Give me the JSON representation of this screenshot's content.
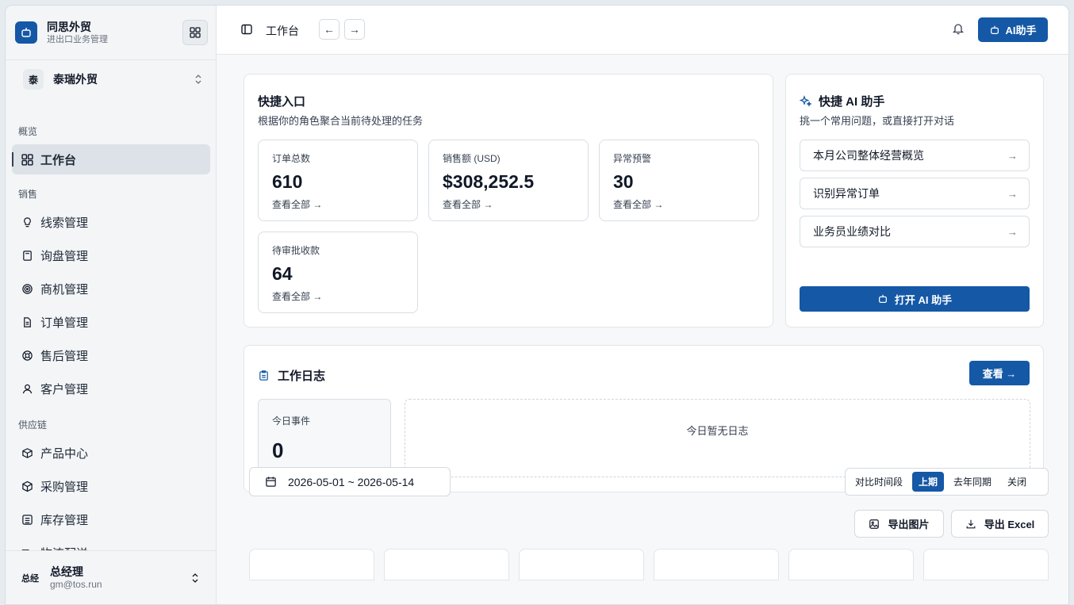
{
  "brand": {
    "name": "同思外贸",
    "subtitle": "进出口业务管理"
  },
  "company": {
    "badge": "泰",
    "name": "泰瑞外贸"
  },
  "sidebar": {
    "sections": {
      "overview": "概览",
      "sales": "销售",
      "supply": "供应链"
    },
    "items": [
      {
        "label": "工作台",
        "icon": "dashboard-icon"
      },
      {
        "label": "线索管理",
        "icon": "lightbulb-icon"
      },
      {
        "label": "询盘管理",
        "icon": "calculator-icon"
      },
      {
        "label": "商机管理",
        "icon": "target-icon"
      },
      {
        "label": "订单管理",
        "icon": "document-icon"
      },
      {
        "label": "售后管理",
        "icon": "lifebuoy-icon"
      },
      {
        "label": "客户管理",
        "icon": "user-icon"
      },
      {
        "label": "产品中心",
        "icon": "package-icon"
      },
      {
        "label": "采购管理",
        "icon": "box-icon"
      },
      {
        "label": "库存管理",
        "icon": "warehouse-icon"
      },
      {
        "label": "物流配送",
        "icon": "truck-icon"
      }
    ]
  },
  "user": {
    "avatar": "总经",
    "name": "总经理",
    "email": "gm@tos.run"
  },
  "header": {
    "title": "工作台",
    "ai_button": "AI助手"
  },
  "quick_entry": {
    "title": "快捷入口",
    "subtitle": "根据你的角色聚合当前待处理的任务",
    "stats": [
      {
        "label": "订单总数",
        "value": "610",
        "link": "查看全部 →"
      },
      {
        "label": "销售额 (USD)",
        "value": "$308,252.5",
        "link": "查看全部 →"
      },
      {
        "label": "异常预警",
        "value": "30",
        "link": "查看全部 →"
      },
      {
        "label": "待审批收款",
        "value": "64",
        "link": "查看全部 →"
      }
    ]
  },
  "quick_ai": {
    "title": "快捷 AI 助手",
    "subtitle": "挑一个常用问题，或直接打开对话",
    "questions": [
      "本月公司整体经营概览",
      "识别异常订单",
      "业务员业绩对比"
    ],
    "open_button": "打开 AI 助手"
  },
  "work_log": {
    "title": "工作日志",
    "view_button": "查看 →",
    "today_label": "今日事件",
    "today_value": "0",
    "empty_text": "今日暂无日志"
  },
  "filters": {
    "date_range": "2026-05-01 ~ 2026-05-14",
    "compare_label": "对比时间段",
    "options": [
      "上期",
      "去年同期",
      "关闭"
    ],
    "selected": "上期",
    "export_image": "导出图片",
    "export_excel": "导出 Excel"
  },
  "colors": {
    "primary": "#1558a6",
    "sidebar_bg": "#f3f5f7",
    "main_bg": "#f6f8fa"
  }
}
